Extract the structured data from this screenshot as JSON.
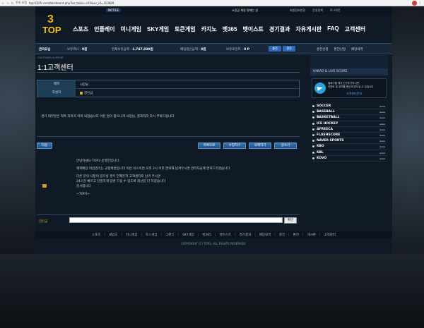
{
  "browser": {
    "warning": "주의 요함",
    "url": "top-6565.com/bbs/board.php?bo_table=z10&wr_id=310689",
    "menu_glyph": "⋮"
  },
  "topline": {
    "notice": "NOTICE",
    "greet": "쇼밍금 계정 명에는 일",
    "links": [
      "회원정보변경",
      "운영정책",
      "로그아웃"
    ]
  },
  "logo": {
    "num": "3",
    "word": "TOP"
  },
  "nav": [
    "스포츠",
    "인플레이",
    "미니게임",
    "SKY게임",
    "토큰게임",
    "카지노",
    "벳365",
    "벳이스트",
    "경기결과",
    "자유게시판",
    "FAQ",
    "고객센터"
  ],
  "infobar": {
    "user": "관리요님",
    "label1": "보유머니 :",
    "val1": "0원",
    "label2": "현재보유금액 :",
    "val2": "1,747,839원",
    "label3": "배팅중인금액 :",
    "val3": "0원",
    "label4": "보유포인트 :",
    "val4": "0 P",
    "btn_a": "충전",
    "btn_b": "환전",
    "right_links": [
      "충전신청",
      "환전신청",
      "배당내역"
    ]
  },
  "content": {
    "crumb": "CUSTOMER SUPPORT",
    "title": "1:1고객센터",
    "subject_label": "제목",
    "subject_value": "사장님",
    "author_label": "작성자",
    "author_value": "강신금",
    "body": "경기 대부분은 적특 처리가 이미 되었습니다 이런 일이 잦으니까 사장님, 결과처리 다시 부탁드립니다",
    "buttons": {
      "next": "다음",
      "list": "목록으로",
      "edit": "수정하기",
      "delete": "삭제하기",
      "write": "글쓰기"
    },
    "reply": [
      "안녕하세요 TOP3 운영진입니다.",
      "해외배당 마감경기는 규정위반입니다 이런 이스이면 오후 2시 이후 연락해 남겨두시면 관리자님께 연락드리겠습니다",
      "다른 문의 사항이 있으실 경우 언제든지 고객센터로 남겨 주시면",
      "24시간 빠르고 친절하게 답변 드릴 수 있도록 최선을 다 하겠습니다",
      "감사합니다",
      "~TOP3~"
    ],
    "comment_label": "강신금",
    "comment_button": "확인"
  },
  "sidebar": {
    "live_title": "KAKAO & LIVE SCORE",
    "tg_text": [
      "텔레그램 에서 친구추가하시면",
      "이벤트 및 공지를 빠르게 받으실 수 있습니다"
    ],
    "tg_link": "고객센터문의",
    "sports": [
      "SOCCER",
      "BASEBALL",
      "BASKETBALL",
      "ICE HOCKEY",
      "AFREECA",
      "FLASHSCORE",
      "NAVER SPORTS",
      "KBO",
      "KBL",
      "KOVO"
    ]
  },
  "footer": {
    "links": [
      "스포츠",
      "내입도",
      "미니게임",
      "토스게임",
      "그랜드",
      "SKY게임",
      "벳365",
      "벳이스트",
      "경기결과",
      "배당내역",
      "충전",
      "환전",
      "게시판",
      "고객센터"
    ],
    "copyright": "COPYRIGHT (C) TOP3. ALL RIGHTS RESERVED."
  },
  "colors": {
    "accent": "#f4c21b",
    "button_blue": "#2f6db8",
    "site_bg": "#0f1a26"
  }
}
